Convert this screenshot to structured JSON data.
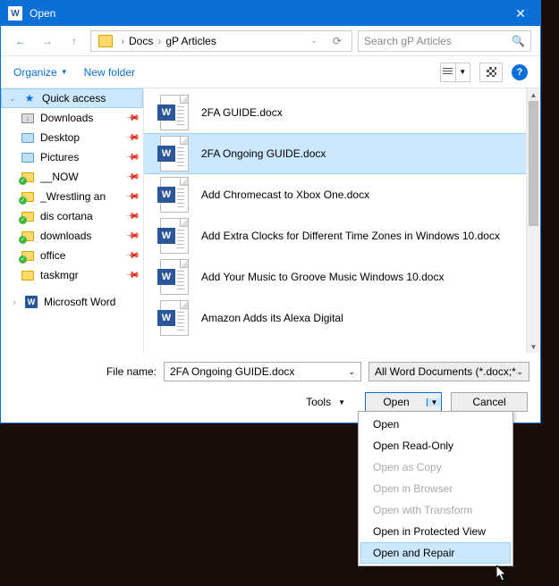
{
  "titlebar": {
    "title": "Open"
  },
  "breadcrumb": {
    "parts": [
      "Docs",
      "gP Articles"
    ]
  },
  "search": {
    "placeholder": "Search gP Articles"
  },
  "toolbar": {
    "organize": "Organize",
    "newfolder": "New folder"
  },
  "sidebar": {
    "items": [
      {
        "label": "Quick access",
        "icon": "star",
        "selected": true
      },
      {
        "label": "Downloads",
        "icon": "downloads",
        "pinned": true
      },
      {
        "label": "Desktop",
        "icon": "desktop",
        "pinned": true
      },
      {
        "label": "Pictures",
        "icon": "pictures",
        "pinned": true
      },
      {
        "label": "__NOW",
        "icon": "folder-green",
        "pinned": true
      },
      {
        "label": "_Wrestling an",
        "icon": "folder-green",
        "pinned": true
      },
      {
        "label": "dis cortana",
        "icon": "folder-green",
        "pinned": true
      },
      {
        "label": "downloads",
        "icon": "folder-green",
        "pinned": true
      },
      {
        "label": "office",
        "icon": "folder-green",
        "pinned": true
      },
      {
        "label": "taskmgr",
        "icon": "folder",
        "pinned": true
      }
    ],
    "footer": {
      "label": "Microsoft Word",
      "icon": "word"
    }
  },
  "files": [
    {
      "name": "2FA GUIDE.docx",
      "selected": false
    },
    {
      "name": "2FA Ongoing GUIDE.docx",
      "selected": true
    },
    {
      "name": "Add Chromecast to Xbox One.docx",
      "selected": false
    },
    {
      "name": "Add Extra Clocks for Different Time Zones in Windows 10.docx",
      "selected": false
    },
    {
      "name": "Add Your Music to Groove Music Windows 10.docx",
      "selected": false
    },
    {
      "name": "Amazon Adds its Alexa Digital",
      "selected": false
    }
  ],
  "footer": {
    "filename_label": "File name:",
    "filename_value": "2FA Ongoing GUIDE.docx",
    "filter": "All Word Documents (*.docx;*.d",
    "tools": "Tools",
    "open": "Open",
    "cancel": "Cancel"
  },
  "dropdown": {
    "items": [
      {
        "label": "Open",
        "state": "normal"
      },
      {
        "label": "Open Read-Only",
        "state": "normal"
      },
      {
        "label": "Open as Copy",
        "state": "disabled"
      },
      {
        "label": "Open in Browser",
        "state": "disabled"
      },
      {
        "label": "Open with Transform",
        "state": "disabled"
      },
      {
        "label": "Open in Protected View",
        "state": "normal"
      },
      {
        "label": "Open and Repair",
        "state": "highlight"
      }
    ]
  }
}
